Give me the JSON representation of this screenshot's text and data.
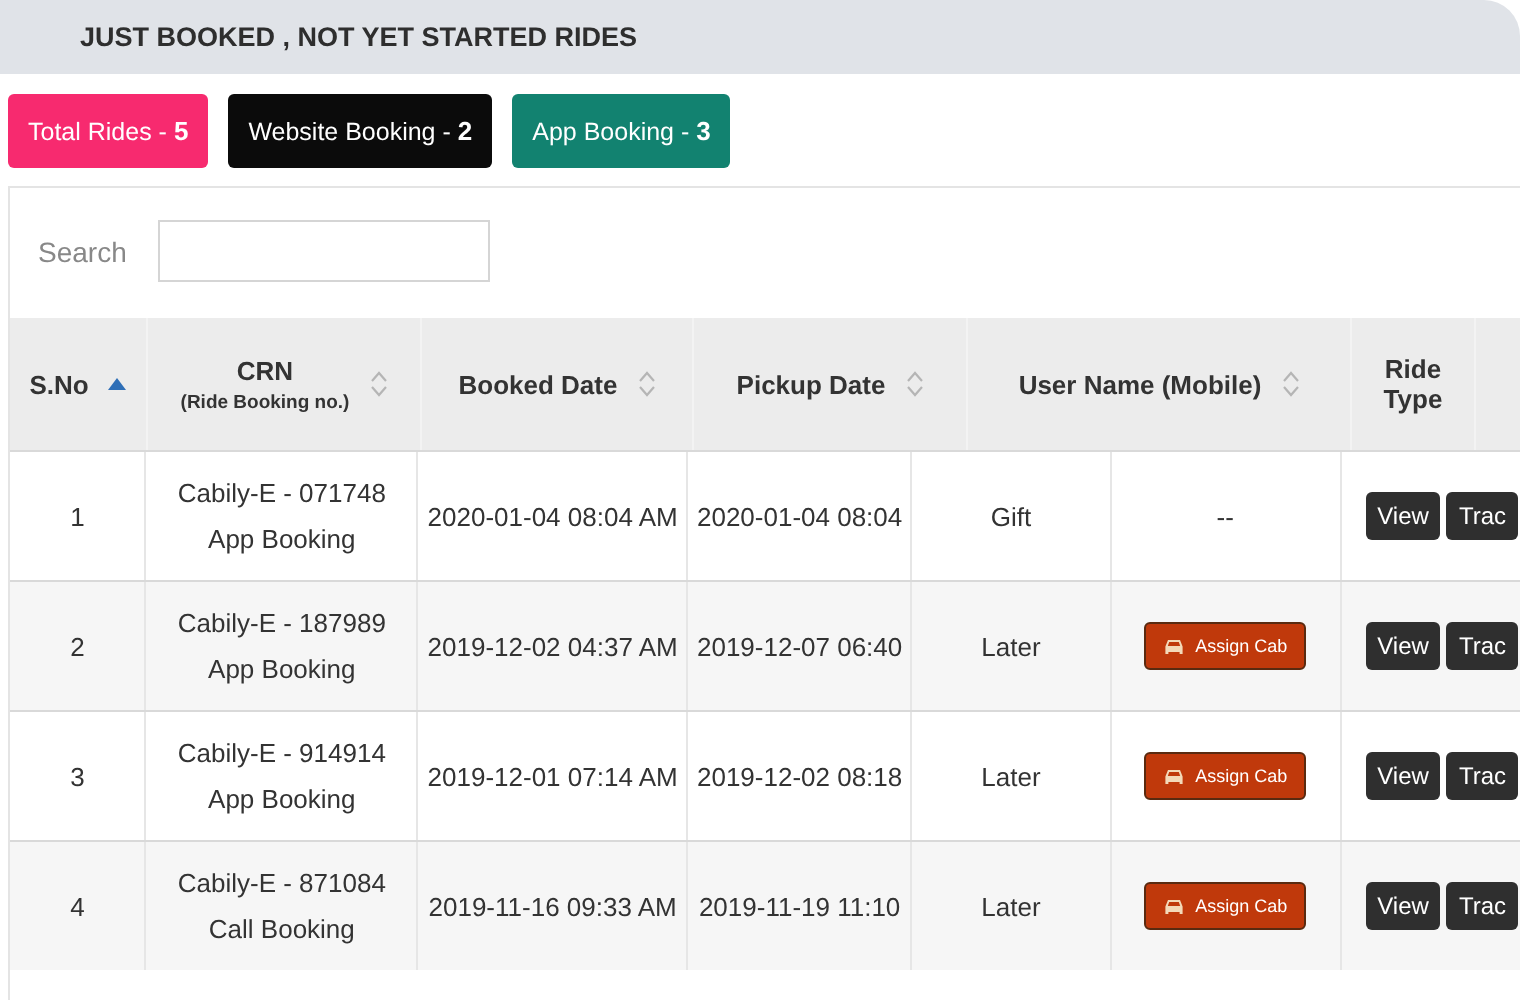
{
  "panel_title": "JUST BOOKED , NOT YET STARTED RIDES",
  "counters": [
    {
      "label": "Total Rides - ",
      "count": "5",
      "color": "#f72a6f"
    },
    {
      "label": "Website Booking - ",
      "count": "2",
      "color": "#0b0b0b"
    },
    {
      "label": "App Booking - ",
      "count": "3",
      "color": "#128270"
    }
  ],
  "search": {
    "label": "Search"
  },
  "table": {
    "columns": [
      {
        "label": "S.No",
        "sortable": true,
        "sorted": true
      },
      {
        "label": "CRN",
        "sublabel": "(Ride Booking no.)",
        "sortable": true,
        "sorted": false
      },
      {
        "label": "Booked Date",
        "sortable": true,
        "sorted": false
      },
      {
        "label": "Pickup Date",
        "sortable": true,
        "sorted": false
      },
      {
        "label": "User Name (Mobile)",
        "sortable": true,
        "sorted": false
      },
      {
        "label": "Ride Type",
        "sortable": false
      }
    ],
    "rows": [
      {
        "sno": "1",
        "crn": "Cabily-E - 071748",
        "booking_type": "App Booking",
        "booked_date": "2020-01-04 08:04 AM",
        "pickup_date": "2020-01-04 08:04",
        "ride_when": "Gift",
        "user": {
          "kind": "text",
          "text": "--"
        },
        "actions": [
          "View",
          "Trac"
        ]
      },
      {
        "sno": "2",
        "crn": "Cabily-E - 187989",
        "booking_type": "App Booking",
        "booked_date": "2019-12-02 04:37 AM",
        "pickup_date": "2019-12-07 06:40",
        "ride_when": "Later",
        "user": {
          "kind": "button",
          "text": "Assign Cab"
        },
        "actions": [
          "View",
          "Trac"
        ]
      },
      {
        "sno": "3",
        "crn": "Cabily-E - 914914",
        "booking_type": "App Booking",
        "booked_date": "2019-12-01 07:14 AM",
        "pickup_date": "2019-12-02 08:18",
        "ride_when": "Later",
        "user": {
          "kind": "button",
          "text": "Assign Cab"
        },
        "actions": [
          "View",
          "Trac"
        ]
      },
      {
        "sno": "4",
        "crn": "Cabily-E - 871084",
        "booking_type": "Call Booking",
        "booked_date": "2019-11-16 09:33 AM",
        "pickup_date": "2019-11-19 11:10",
        "ride_when": "Later",
        "user": {
          "kind": "button",
          "text": "Assign Cab"
        },
        "actions": [
          "View",
          "Trac"
        ]
      }
    ]
  }
}
